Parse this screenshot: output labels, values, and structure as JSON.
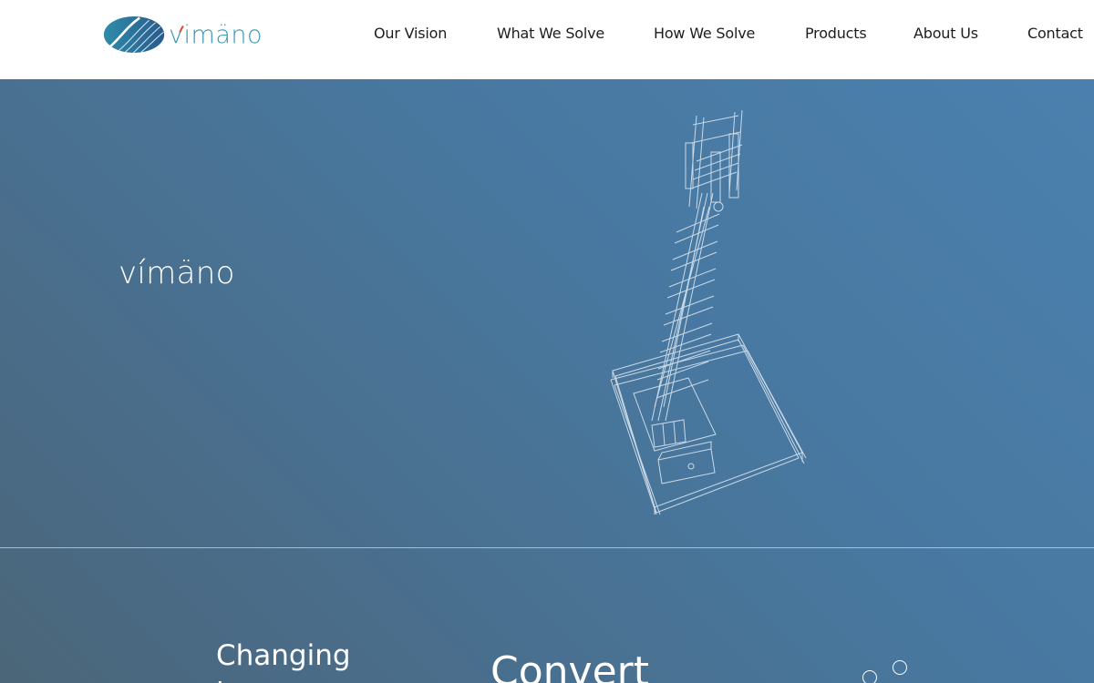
{
  "brand": {
    "logo_text": "vimäno",
    "hero_title": "vímäno",
    "accent_color": "#d24a3a",
    "logo_color": "#3a97b4"
  },
  "nav": {
    "items": [
      {
        "label": "Our Vision"
      },
      {
        "label": "What We Solve"
      },
      {
        "label": "How We Solve"
      },
      {
        "label": "Products"
      },
      {
        "label": "About Us"
      },
      {
        "label": "Contact"
      }
    ]
  },
  "hero": {
    "background_colors": [
      "#4b80ae",
      "#4b6678"
    ],
    "illustration": "cell-tower-wireframe"
  },
  "sections": {
    "left_heading_line1": "Changing",
    "left_heading_line2": "t",
    "center_heading": "Convert",
    "decoration": "bubbles-icon"
  }
}
